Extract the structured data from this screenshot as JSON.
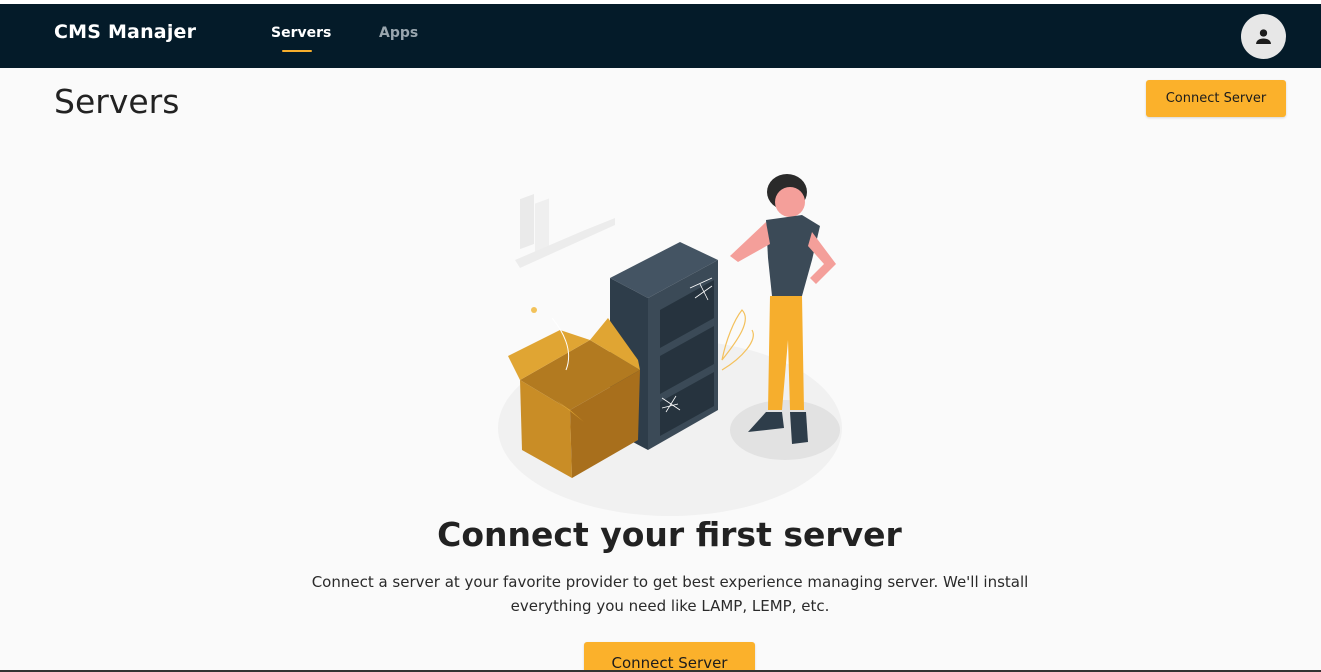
{
  "header": {
    "brand": "CMS Manajer",
    "tabs": [
      {
        "label": "Servers",
        "active": true
      },
      {
        "label": "Apps",
        "active": false
      }
    ],
    "avatar_icon": "person-icon"
  },
  "page": {
    "title": "Servers",
    "connect_button_label": "Connect Server"
  },
  "empty_state": {
    "illustration": "person-with-empty-shelf-and-box",
    "title": "Connect your first server",
    "description": "Connect a server at your favorite provider to get best experience managing server. We'll install everything you need like LAMP, LEMP, etc.",
    "button_label": "Connect Server"
  },
  "colors": {
    "header_bg": "#041b29",
    "accent": "#fbb12b",
    "page_bg": "#fafafa"
  }
}
